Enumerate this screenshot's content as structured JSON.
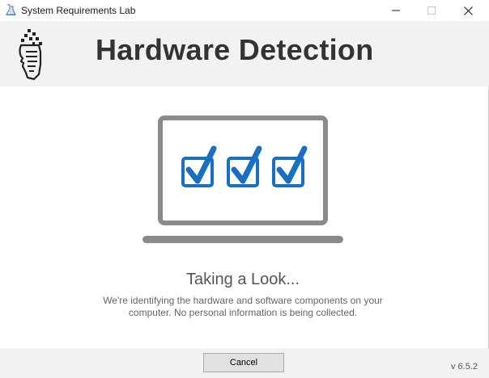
{
  "window": {
    "title": "System Requirements Lab"
  },
  "header": {
    "title": "Hardware Detection"
  },
  "status": {
    "title": "Taking a Look...",
    "line1": "We're identifying the hardware and software components on your",
    "line2": "computer. No personal information is being collected."
  },
  "footer": {
    "cancel_label": "Cancel",
    "version": "v 6.5.2"
  },
  "colors": {
    "header_bg": "#f2f2f2",
    "laptop_gray": "#8a8a8a",
    "checkbox_blue": "#1a6fc2"
  }
}
